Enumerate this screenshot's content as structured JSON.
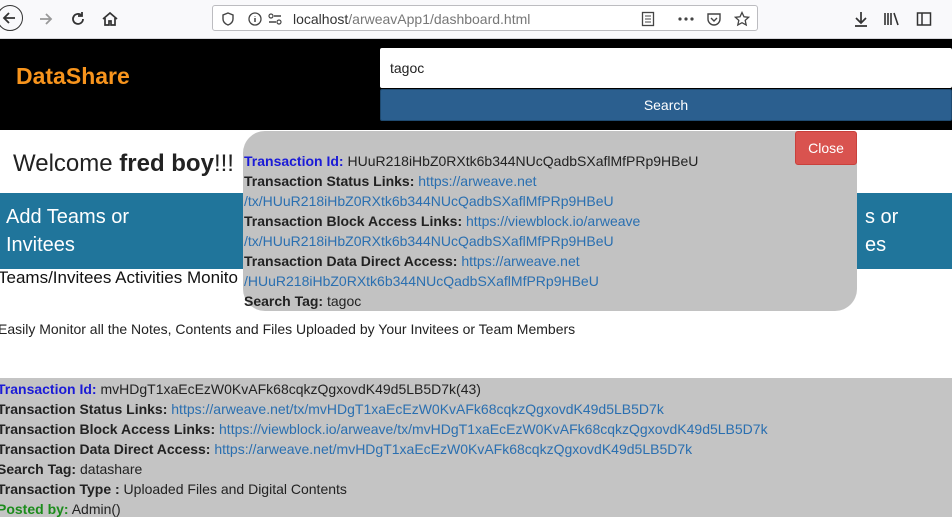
{
  "browser": {
    "url_host": "localhost",
    "url_path": "/arweavApp1/dashboard.html",
    "icons": [
      "back-icon",
      "forward-icon",
      "reload-icon",
      "home-icon",
      "shield-icon",
      "info-icon",
      "permissions-icon",
      "reader-view-icon",
      "more-icon",
      "pocket-icon",
      "bookmark-star-icon",
      "download-icon",
      "library-icon",
      "sidebar-icon"
    ]
  },
  "header": {
    "brand": "DataShare",
    "search_value": "tagoc",
    "search_button": "Search"
  },
  "welcome": {
    "prefix": "Welcome ",
    "name": "fred boy",
    "suffix": "!!!"
  },
  "tiles": {
    "left_line1": "Add Teams or",
    "left_line2": "Invitees",
    "right_line1": "s or",
    "right_line2": "es"
  },
  "monitor": {
    "title": "Teams/Invitees Activities Monito",
    "description": "Easily Monitor all the Notes, Contents and Files Uploaded by Your Invitees or Team Members"
  },
  "record": {
    "tx_id_label": "Transaction Id:",
    "tx_id_value": " mvHDgT1xaEcEzW0KvAFk68cqkzQgxovdK49d5LB5D7k(43)",
    "status_label": "Transaction Status Links:",
    "status_link": "https://arweave.net/tx/mvHDgT1xaEcEzW0KvAFk68cqkzQgxovdK49d5LB5D7k",
    "block_label": "Transaction Block Access Links:",
    "block_link": "https://viewblock.io/arweave/tx/mvHDgT1xaEcEzW0KvAFk68cqkzQgxovdK49d5LB5D7k",
    "direct_label": "Transaction Data Direct Access:",
    "direct_link": "https://arweave.net/mvHDgT1xaEcEzW0KvAFk68cqkzQgxovdK49d5LB5D7k",
    "tag_label": "Search Tag:",
    "tag_value": " datashare",
    "type_label": "Transaction Type :",
    "type_value": " Uploaded Files and Digital Contents",
    "posted_label": "Posted by:",
    "posted_value": " Admin()"
  },
  "popup": {
    "close_label": "Close",
    "tx_id_label": "Transaction Id:",
    "tx_id_value": " HUuR218iHbZ0RXtk6b344NUcQadbSXaflMfPRp9HBeU",
    "status_label": "Transaction Status Links:",
    "status_link_1": "https://arweave.net",
    "status_link_2": "/tx/HUuR218iHbZ0RXtk6b344NUcQadbSXaflMfPRp9HBeU",
    "block_label": "Transaction Block Access Links:",
    "block_link_1": "https://viewblock.io/arweave",
    "block_link_2": "/tx/HUuR218iHbZ0RXtk6b344NUcQadbSXaflMfPRp9HBeU",
    "direct_label": "Transaction Data Direct Access:",
    "direct_link_1": "https://arweave.net",
    "direct_link_2": "/HUuR218iHbZ0RXtk6b344NUcQadbSXaflMfPRp9HBeU",
    "tag_label": "Search Tag:",
    "tag_value": " tagoc"
  },
  "colors": {
    "brand": "#f7941d",
    "tile": "#20759b",
    "search_button": "#2b5f8f",
    "close_button": "#d9534f",
    "link": "#2a6fb0"
  }
}
